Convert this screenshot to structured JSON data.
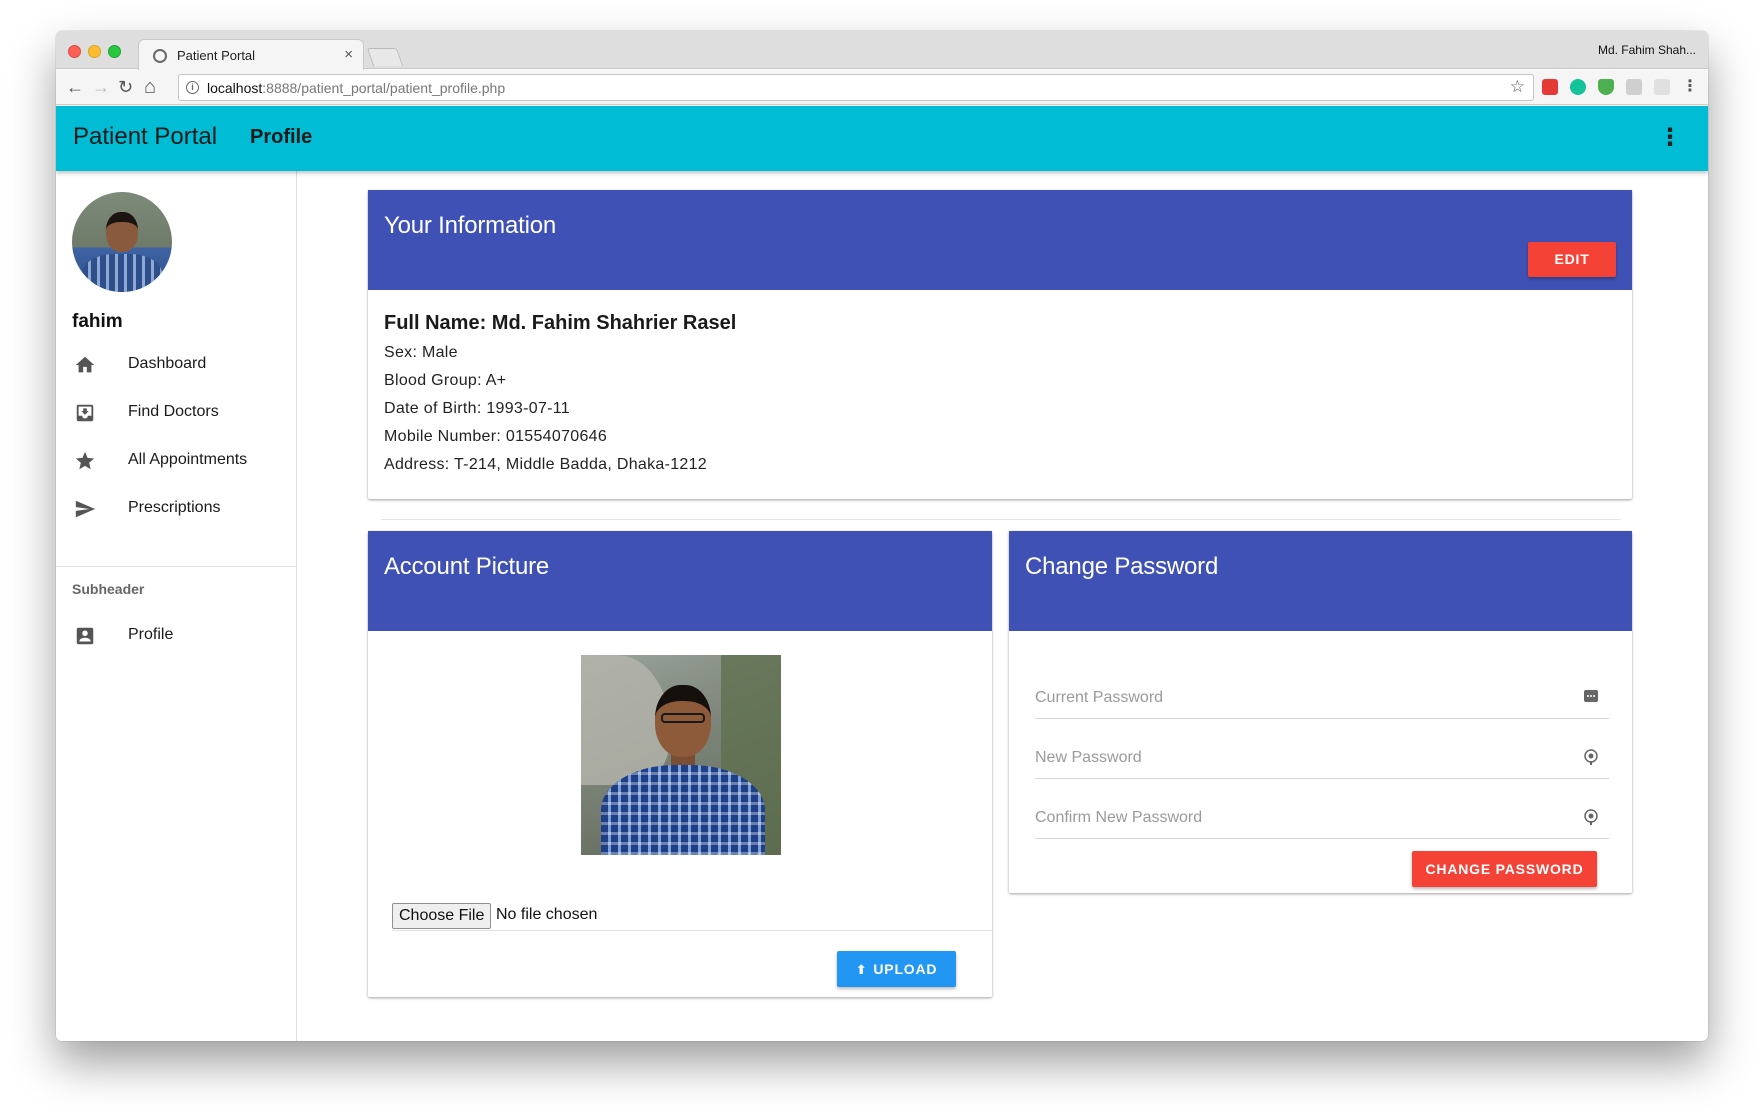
{
  "browser": {
    "tab_title": "Patient Portal",
    "tab_close": "×",
    "profile_name": "Md. Fahim Shah...",
    "url_host": "localhost",
    "url_path": ":8888/patient_portal/patient_profile.php",
    "nav_back": "←",
    "nav_forward": "→",
    "nav_reload": "↻",
    "nav_home": "⌂",
    "bookmark_star": "☆",
    "menu_dots": "⋮"
  },
  "appbar": {
    "title": "Patient Portal",
    "nav_profile": "Profile",
    "menu": "⋮",
    "color": "#00bcd4"
  },
  "sidebar": {
    "username": "fahim",
    "items": [
      {
        "label": "Dashboard",
        "icon": "home-icon"
      },
      {
        "label": "Find Doctors",
        "icon": "inbox-download-icon"
      },
      {
        "label": "All Appointments",
        "icon": "star-icon"
      },
      {
        "label": "Prescriptions",
        "icon": "send-icon"
      }
    ],
    "subheader": "Subheader",
    "sub_items": [
      {
        "label": "Profile",
        "icon": "account-box-icon"
      }
    ]
  },
  "info_card": {
    "title": "Your Information",
    "edit_label": "EDIT",
    "full_name": "Full Name: Md. Fahim Shahrier Rasel",
    "sex": "Sex: Male",
    "blood_group": "Blood Group: A+",
    "dob": "Date of Birth: 1993-07-11",
    "mobile": "Mobile Number: 01554070646",
    "address": "Address: T-214, Middle Badda, Dhaka-1212"
  },
  "picture_card": {
    "title": "Account Picture",
    "choose_file": "Choose File",
    "file_status": "No file chosen",
    "upload_label": "UPLOAD",
    "upload_icon": "⬆"
  },
  "password_card": {
    "title": "Change Password",
    "current_placeholder": "Current Password",
    "new_placeholder": "New Password",
    "confirm_placeholder": "Confirm New Password",
    "submit_label": "CHANGE PASSWORD"
  },
  "colors": {
    "primary": "#3f51b5",
    "accent_red": "#f44336",
    "upload_blue": "#2196f3"
  }
}
